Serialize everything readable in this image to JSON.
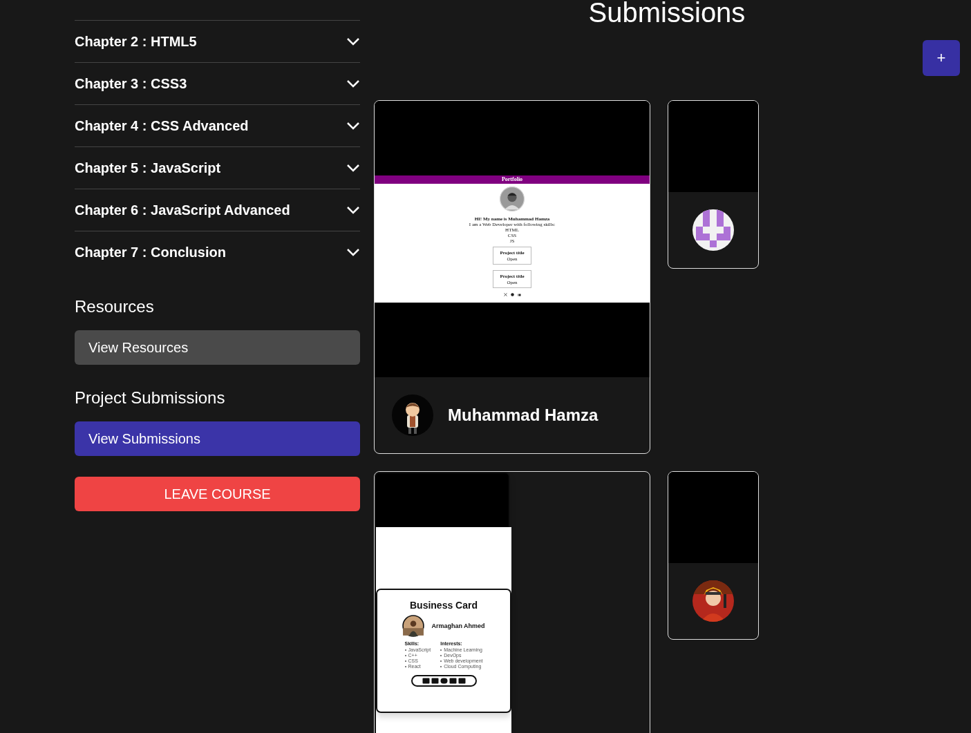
{
  "chapters": [
    {
      "title": "Chapter 2 : HTML5",
      "expanded": false
    },
    {
      "title": "Chapter 3 : CSS3",
      "expanded": false
    },
    {
      "title": "Chapter 4 : CSS Advanced",
      "expanded": false
    },
    {
      "title": "Chapter 5 : JavaScript",
      "expanded": false
    },
    {
      "title": "Chapter 6 : JavaScript Advanced",
      "expanded": false
    },
    {
      "title": "Chapter 7 : Conclusion",
      "expanded": false
    }
  ],
  "resources": {
    "heading": "Resources",
    "button": "View Resources"
  },
  "project_submissions": {
    "heading": "Project Submissions",
    "button": "View Submissions"
  },
  "leave_button": "LEAVE COURSE",
  "page_title": "Submissions",
  "add_button": "+",
  "submissions": [
    {
      "kind": "portfolio",
      "preview": {
        "header": "Portfolio",
        "greeting": "HI! My name is Muhammad Hamza",
        "intro": "I am a Web Developer with following skills:",
        "skills": [
          "HTML",
          "CSS",
          "JS"
        ],
        "projects": [
          {
            "title": "Project title",
            "link": "Open"
          },
          {
            "title": "Project title",
            "link": "Open"
          }
        ]
      },
      "author": "Muhammad Hamza"
    },
    {
      "kind": "blank"
    },
    {
      "kind": "business_card",
      "preview": {
        "title": "Business Card",
        "name": "Armaghan Ahmed",
        "skills_label": "Skills:",
        "skills": [
          "JavaScript",
          "C++",
          "CSS",
          "React"
        ],
        "interests_label": "Interests:",
        "interests": [
          "Machine Learning",
          "DevOps",
          "Web development",
          "Cloud Computing"
        ]
      }
    },
    {
      "kind": "blank"
    }
  ]
}
